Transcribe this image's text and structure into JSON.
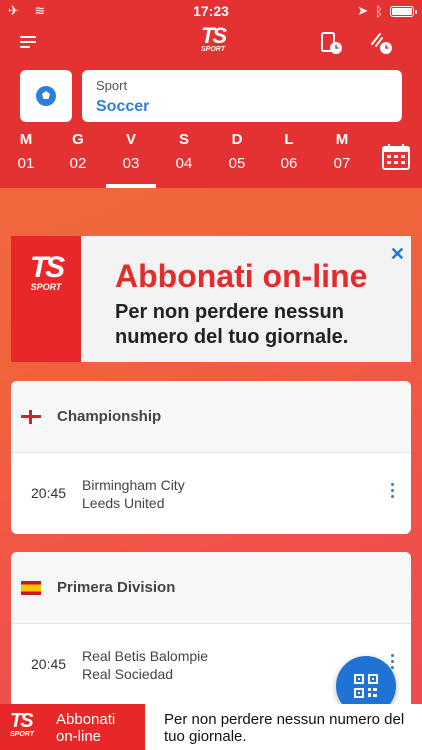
{
  "status": {
    "time": "17:23"
  },
  "header": {
    "logo": "TS",
    "logo_sub": "SPORT"
  },
  "sport": {
    "label": "Sport",
    "value": "Soccer"
  },
  "days": [
    {
      "name": "M",
      "num": "01"
    },
    {
      "name": "G",
      "num": "02"
    },
    {
      "name": "V",
      "num": "03"
    },
    {
      "name": "S",
      "num": "04"
    },
    {
      "name": "D",
      "num": "05"
    },
    {
      "name": "L",
      "num": "06"
    },
    {
      "name": "M",
      "num": "07"
    }
  ],
  "banner": {
    "logo": "TS",
    "logo_sub": "SPORT",
    "title": "Abbonati on-line",
    "subtitle": "Per non perdere nessun numero del tuo giornale.",
    "close": "✕"
  },
  "leagues": [
    {
      "name": "Championship",
      "matches": [
        {
          "time": "20:45",
          "home": "Birmingham City",
          "away": "Leeds United"
        }
      ]
    },
    {
      "name": "Primera Division",
      "matches": [
        {
          "time": "20:45",
          "home": "Real Betis Balompie",
          "away": "Real Sociedad"
        }
      ]
    }
  ],
  "bottom_banner": {
    "logo": "TS",
    "logo_sub": "SPORT",
    "label": "Abbonati on-line",
    "message": "Per non perdere nessun numero del tuo giornale."
  },
  "colors": {
    "header_red": "#e43233",
    "accent_blue": "#1e73d4"
  }
}
